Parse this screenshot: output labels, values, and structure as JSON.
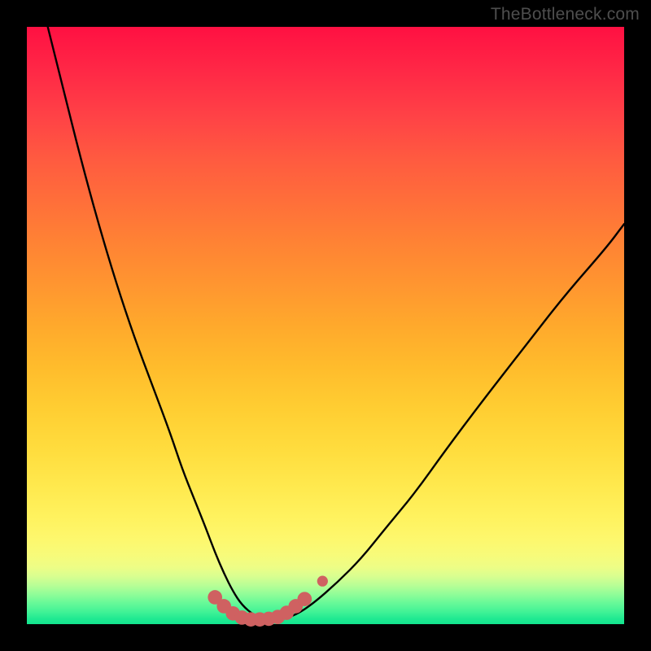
{
  "watermark": "TheBottleneck.com",
  "colors": {
    "frame": "#000000",
    "curve_stroke": "#000000",
    "marker_fill": "#cf6161",
    "gradient_top": "#ff1042",
    "gradient_bottom": "#12e48e"
  },
  "chart_data": {
    "type": "line",
    "title": "",
    "xlabel": "",
    "ylabel": "",
    "xlim": [
      0,
      100
    ],
    "ylim": [
      0,
      100
    ],
    "grid": false,
    "legend": false,
    "series": [
      {
        "name": "bottleneck-curve",
        "x": [
          3.5,
          6,
          9,
          12,
          15,
          18,
          21,
          24,
          26,
          28,
          30,
          31.5,
          33,
          34.5,
          36,
          38,
          40,
          42,
          45,
          48,
          52,
          56,
          60,
          65,
          70,
          76,
          83,
          90,
          97,
          100
        ],
        "y": [
          100,
          90,
          78,
          67,
          57,
          48,
          40,
          32,
          26,
          21,
          16,
          12,
          8.5,
          5.5,
          3.2,
          1.5,
          0.6,
          0.6,
          1.5,
          3.5,
          7,
          11,
          16,
          22,
          29,
          37,
          46,
          55,
          63,
          67
        ]
      }
    ],
    "markers": [
      {
        "x": 31.5,
        "y": 4.5,
        "r": 1.2
      },
      {
        "x": 33.0,
        "y": 3.0,
        "r": 1.2
      },
      {
        "x": 34.5,
        "y": 1.8,
        "r": 1.2
      },
      {
        "x": 36.0,
        "y": 1.1,
        "r": 1.2
      },
      {
        "x": 37.5,
        "y": 0.8,
        "r": 1.2
      },
      {
        "x": 39.0,
        "y": 0.8,
        "r": 1.2
      },
      {
        "x": 40.5,
        "y": 0.9,
        "r": 1.2
      },
      {
        "x": 42.0,
        "y": 1.2,
        "r": 1.2
      },
      {
        "x": 43.5,
        "y": 1.9,
        "r": 1.2
      },
      {
        "x": 45.0,
        "y": 3.0,
        "r": 1.2
      },
      {
        "x": 46.5,
        "y": 4.2,
        "r": 1.2
      },
      {
        "x": 49.5,
        "y": 7.2,
        "r": 0.9
      }
    ]
  }
}
